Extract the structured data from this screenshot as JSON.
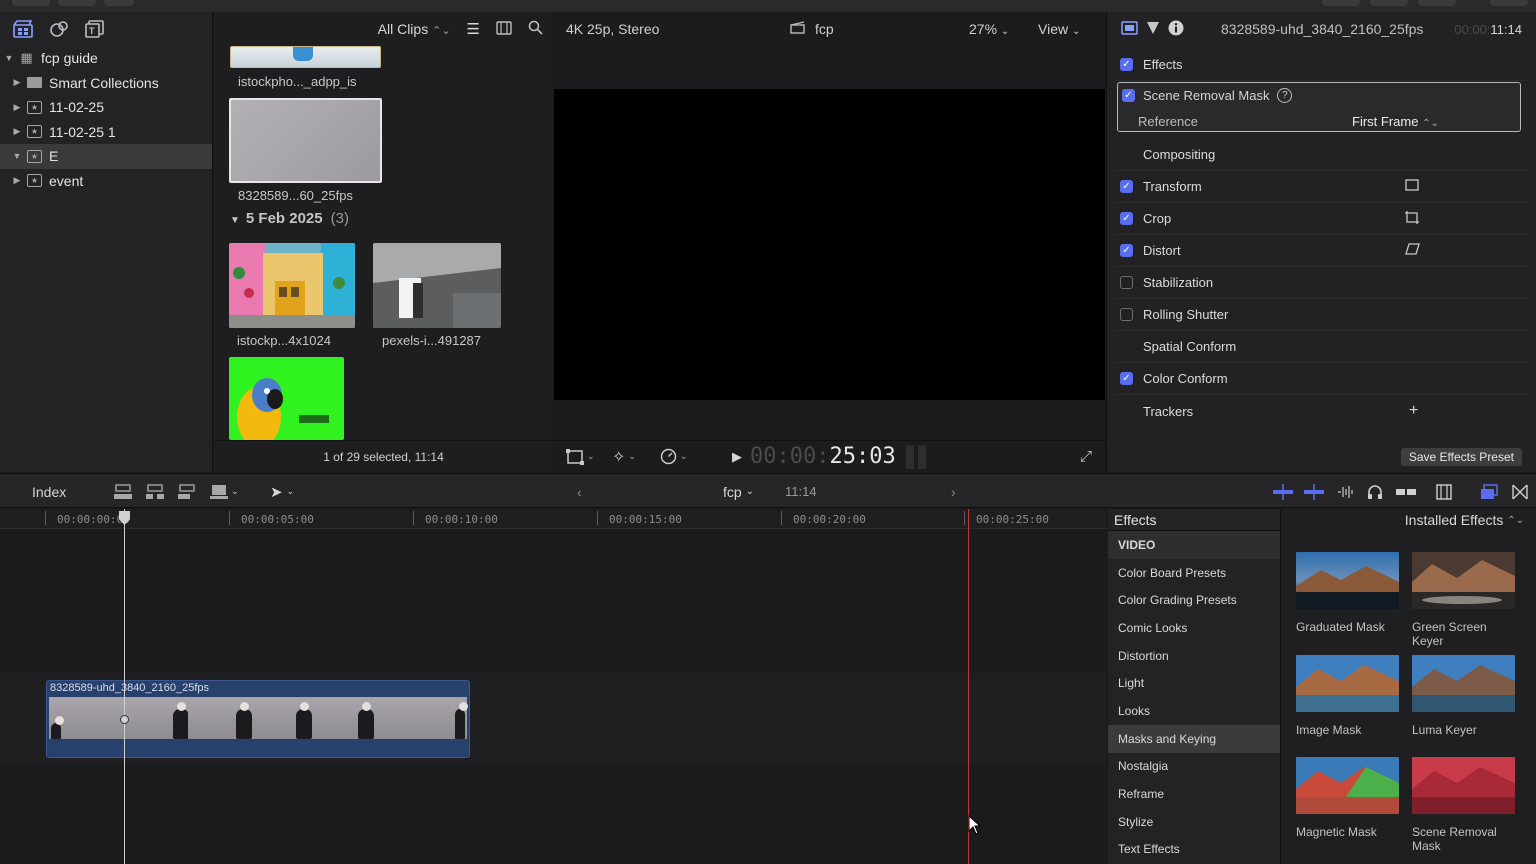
{
  "library": {
    "items": [
      {
        "label": "fcp guide",
        "icon": "library-icon",
        "expanded": true,
        "level": 0
      },
      {
        "label": "Smart Collections",
        "icon": "folder-icon",
        "expanded": false,
        "level": 1
      },
      {
        "label": "11-02-25",
        "icon": "event-icon",
        "expanded": false,
        "level": 1
      },
      {
        "label": "11-02-25 1",
        "icon": "event-icon",
        "expanded": false,
        "level": 1
      },
      {
        "label": "E",
        "icon": "event-icon",
        "expanded": true,
        "level": 1,
        "selected": true
      },
      {
        "label": "event",
        "icon": "event-icon",
        "expanded": false,
        "level": 1
      }
    ]
  },
  "browser": {
    "filter": "All Clips",
    "clips": [
      {
        "label": "istockpho..._adpp_is"
      },
      {
        "label": "8328589...60_25fps"
      },
      {
        "label": "istockp...4x1024"
      },
      {
        "label": "pexels-i...491287"
      }
    ],
    "date_group": {
      "label": "5 Feb 2025",
      "count": "(3)"
    },
    "status": "1 of 29 selected, 11:14"
  },
  "viewer": {
    "format": "4K 25p, Stereo",
    "project": "fcp",
    "zoom": "27%",
    "view_label": "View",
    "timecode_dim": "00:00:",
    "timecode": "25:03"
  },
  "inspector": {
    "clip_name": "8328589-uhd_3840_2160_25fps",
    "duration_dim": "00:00:",
    "duration": "11:14",
    "effects_label": "Effects",
    "mask_effect": {
      "label": "Scene Removal Mask",
      "param_label": "Reference",
      "param_value": "First Frame"
    },
    "rows": [
      {
        "label": "Compositing",
        "checkbox": "none"
      },
      {
        "label": "Transform",
        "checkbox": "on",
        "icon": "transform-icon"
      },
      {
        "label": "Crop",
        "checkbox": "on",
        "icon": "crop-icon"
      },
      {
        "label": "Distort",
        "checkbox": "on",
        "icon": "distort-icon"
      },
      {
        "label": "Stabilization",
        "checkbox": "off"
      },
      {
        "label": "Rolling Shutter",
        "checkbox": "off"
      },
      {
        "label": "Spatial Conform",
        "checkbox": "none"
      },
      {
        "label": "Color Conform",
        "checkbox": "on"
      },
      {
        "label": "Trackers",
        "checkbox": "none",
        "add": "+"
      }
    ],
    "save_preset": "Save Effects Preset"
  },
  "timeline_bar": {
    "index": "Index",
    "project": "fcp",
    "duration": "11:14"
  },
  "timeline": {
    "ticks": [
      "00:00:00:00",
      "00:00:05:00",
      "00:00:10:00",
      "00:00:15:00",
      "00:00:20:00",
      "00:00:25:00"
    ],
    "clip_name": "8328589-uhd_3840_2160_25fps"
  },
  "effects_browser": {
    "title": "Effects",
    "installed": "Installed Effects",
    "categories": [
      "VIDEO",
      "Color Board Presets",
      "Color Grading Presets",
      "Comic Looks",
      "Distortion",
      "Light",
      "Looks",
      "Masks and Keying",
      "Nostalgia",
      "Reframe",
      "Stylize",
      "Text Effects"
    ],
    "selected_category": "Masks and Keying",
    "tiles": [
      {
        "name": "Graduated Mask"
      },
      {
        "name": "Green Screen Keyer"
      },
      {
        "name": "Image Mask"
      },
      {
        "name": "Luma Keyer"
      },
      {
        "name": "Magnetic Mask"
      },
      {
        "name": "Scene Removal Mask"
      }
    ]
  },
  "colors": {
    "accent": "#5a6cf0",
    "playhead_red": "#c8342f",
    "clip_blue": "#28406c"
  }
}
